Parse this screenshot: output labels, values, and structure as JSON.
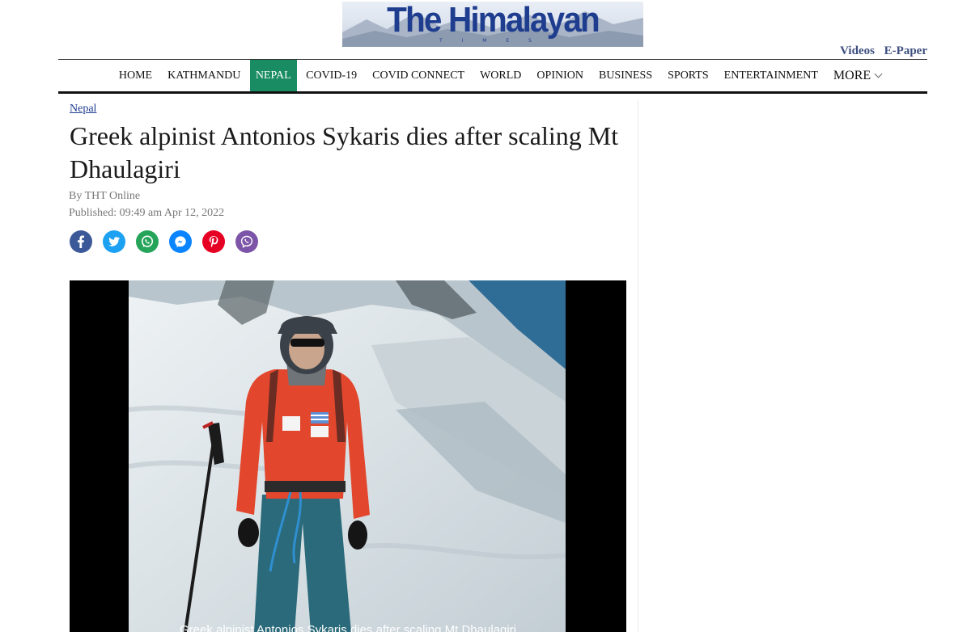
{
  "masthead": {
    "logo_text": "The Himalayan",
    "logo_sub": "T I M E S"
  },
  "top_links": [
    "Videos",
    "E-Paper"
  ],
  "nav": {
    "items": [
      {
        "label": "HOME"
      },
      {
        "label": "KATHMANDU"
      },
      {
        "label": "NEPAL",
        "active": true
      },
      {
        "label": "COVID-19"
      },
      {
        "label": "COVID CONNECT"
      },
      {
        "label": "WORLD"
      },
      {
        "label": "OPINION"
      },
      {
        "label": "BUSINESS"
      },
      {
        "label": "SPORTS"
      },
      {
        "label": "ENTERTAINMENT"
      },
      {
        "label": "MORE"
      }
    ],
    "active_color": "#198c63"
  },
  "article": {
    "category": "Nepal",
    "headline": "Greek alpinist Antonios Sykaris dies after scaling Mt Dhaulagiri",
    "byline": "By THT Online",
    "published": "Published: 09:49 am Apr 12, 2022",
    "share_icons": [
      "facebook-icon",
      "twitter-icon",
      "whatsapp-icon",
      "messenger-icon",
      "pinterest-icon",
      "viber-icon"
    ],
    "image_caption": "Greek alpinist Antonios Sykaris dies after scaling Mt Dhaulagiri"
  }
}
